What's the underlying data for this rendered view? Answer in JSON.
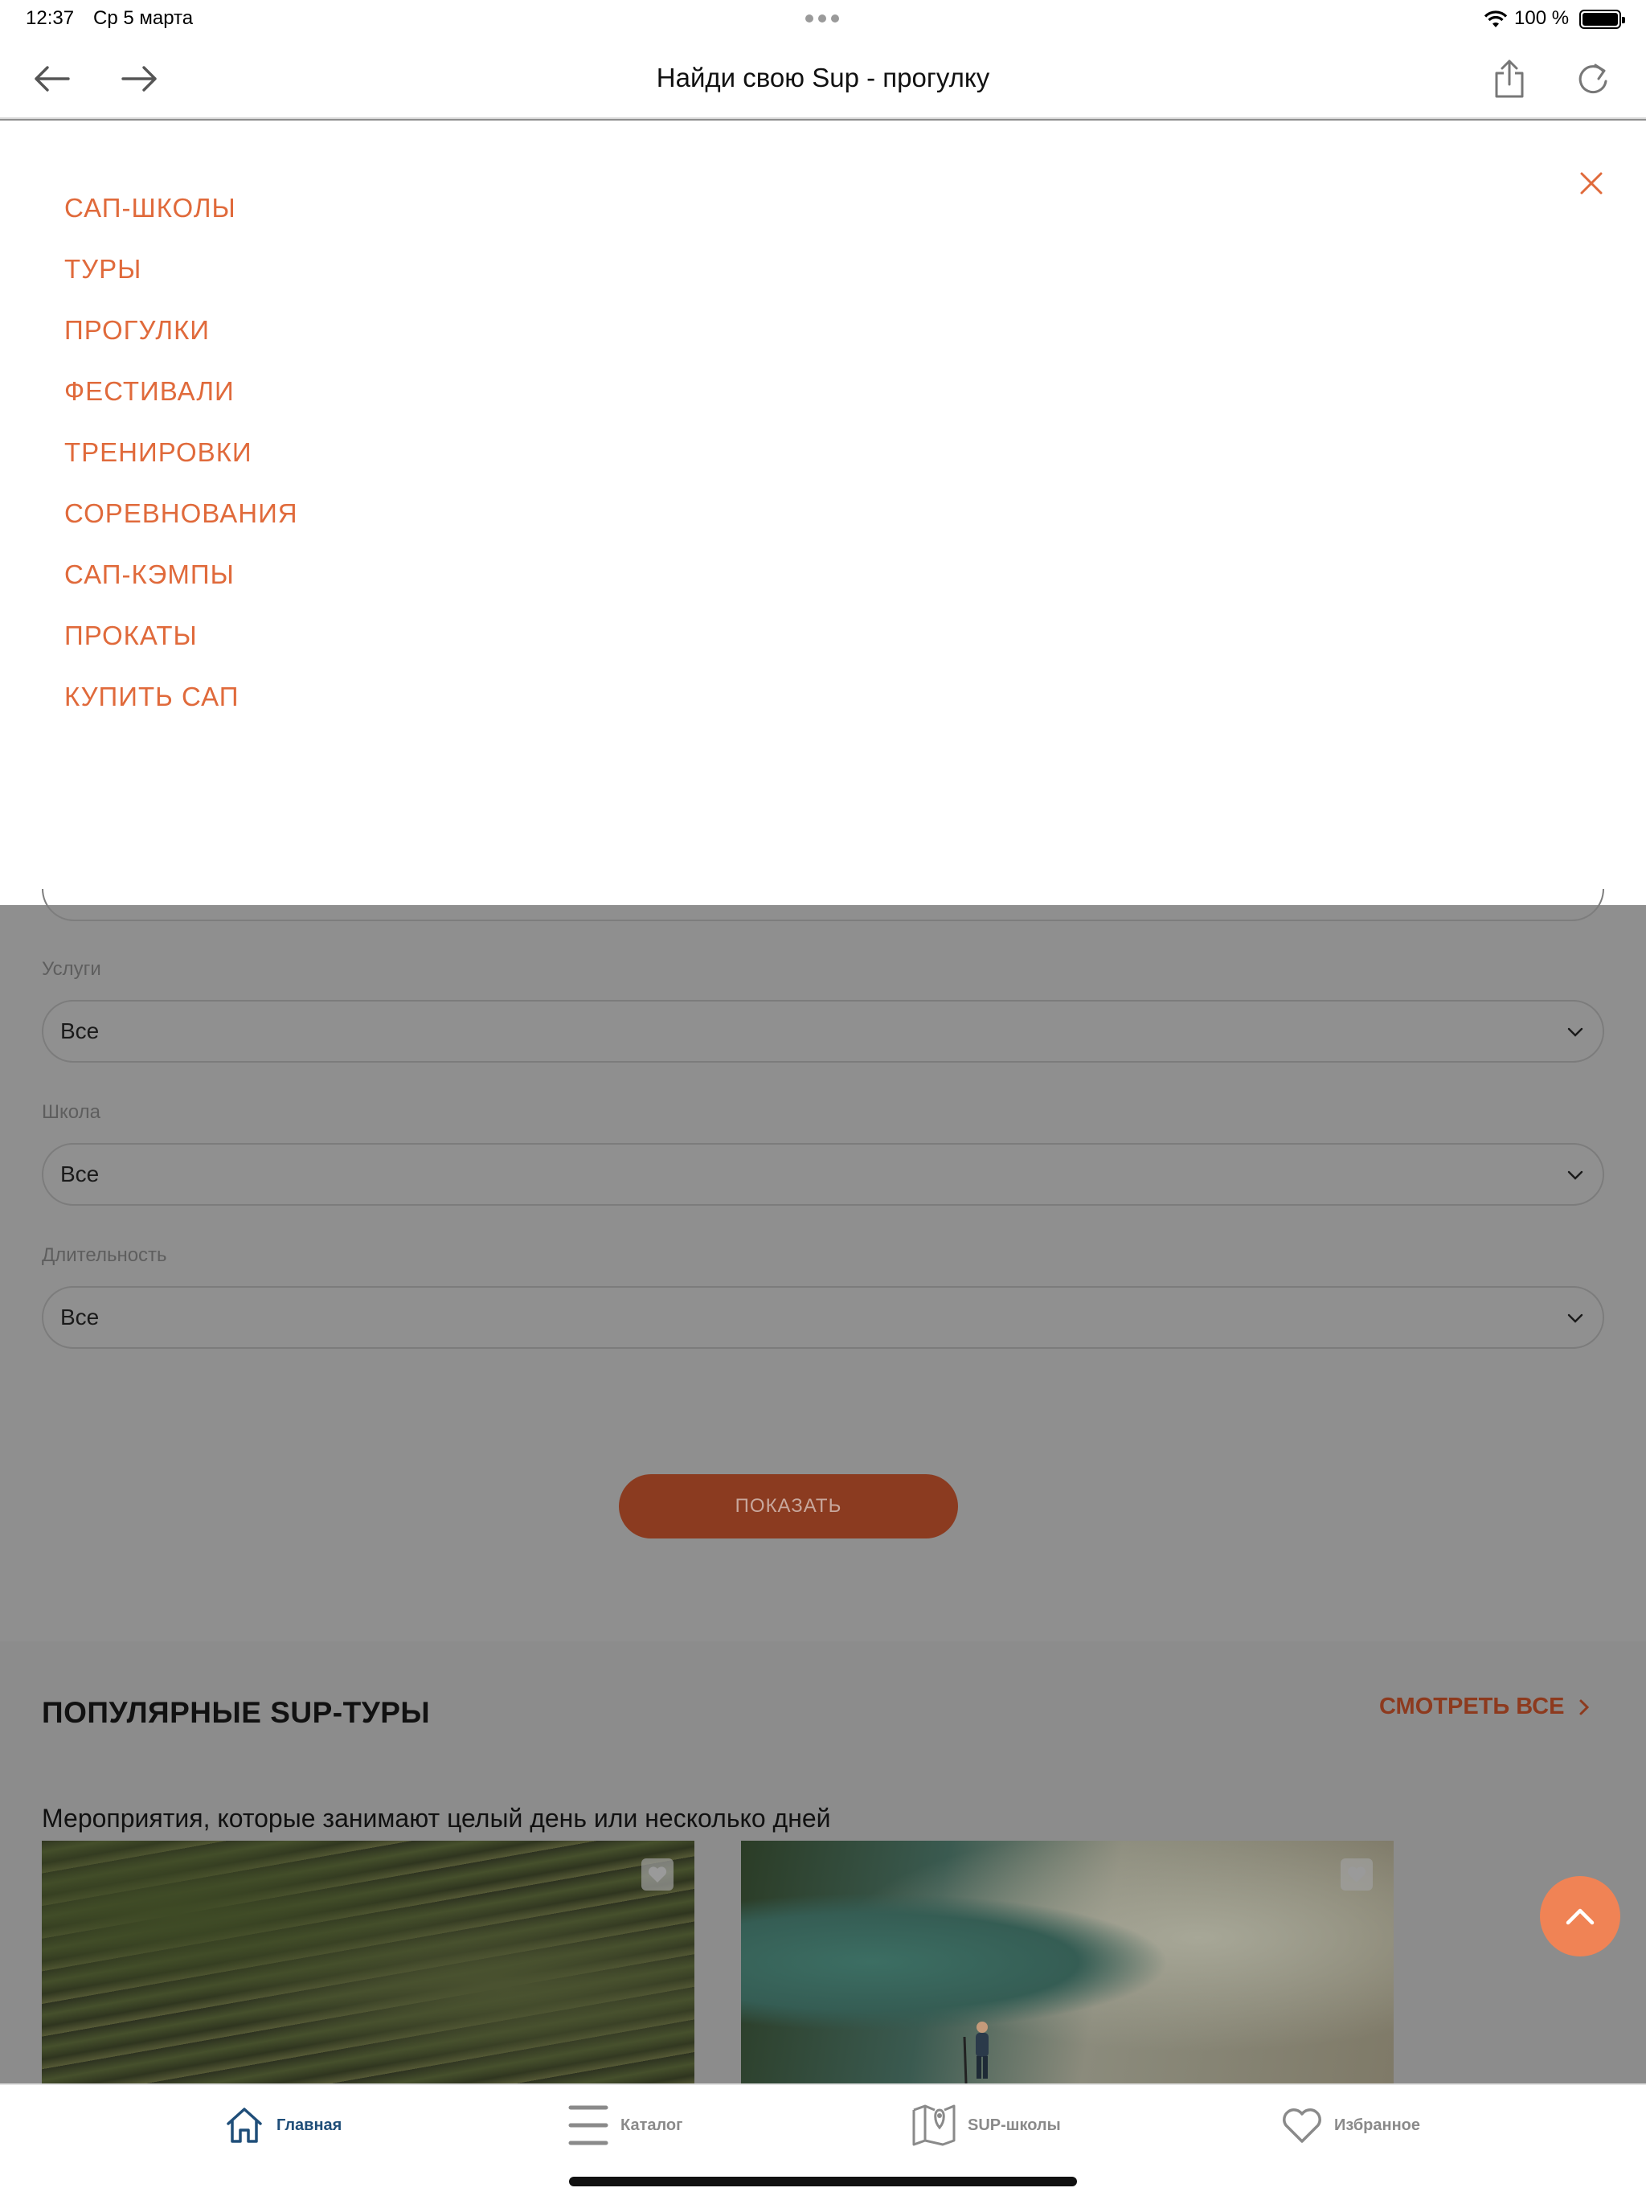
{
  "status_bar": {
    "time": "12:37",
    "date": "Ср 5 марта",
    "battery": "100 %"
  },
  "browser": {
    "title": "Найди свою Sup - прогулку",
    "icons": [
      "arrow-left-icon",
      "arrow-right-icon",
      "share-icon",
      "reload-icon"
    ]
  },
  "menu": {
    "accent_color": "#e06a3b",
    "items": [
      {
        "label": "САП-ШКОЛЫ"
      },
      {
        "label": "ТУРЫ"
      },
      {
        "label": "ПРОГУЛКИ"
      },
      {
        "label": "ФЕСТИВАЛИ"
      },
      {
        "label": "ТРЕНИРОВКИ"
      },
      {
        "label": "СОРЕВНОВАНИЯ"
      },
      {
        "label": "САП-КЭМПЫ"
      },
      {
        "label": "ПРОКАТЫ"
      },
      {
        "label": "КУПИТЬ САП"
      }
    ]
  },
  "filters": {
    "services": {
      "label": "Услуги",
      "value": "Все"
    },
    "school": {
      "label": "Школа",
      "value": "Все"
    },
    "duration": {
      "label": "Длительность",
      "value": "Все"
    },
    "show_button": "ПОКАЗАТЬ"
  },
  "tours": {
    "title": "ПОПУЛЯРНЫЕ SUP-ТУРЫ",
    "see_all": "СМОТРЕТЬ ВСЕ",
    "subtitle": "Мероприятия, которые занимают целый день или несколько дней"
  },
  "tabbar": {
    "active_color": "#1f4e79",
    "tabs": [
      {
        "label": "Главная",
        "icon": "home-icon"
      },
      {
        "label": "Каталог",
        "icon": "menu-icon"
      },
      {
        "label": "SUP-школы",
        "icon": "map-icon"
      },
      {
        "label": "Избранное",
        "icon": "heart-icon"
      }
    ]
  }
}
